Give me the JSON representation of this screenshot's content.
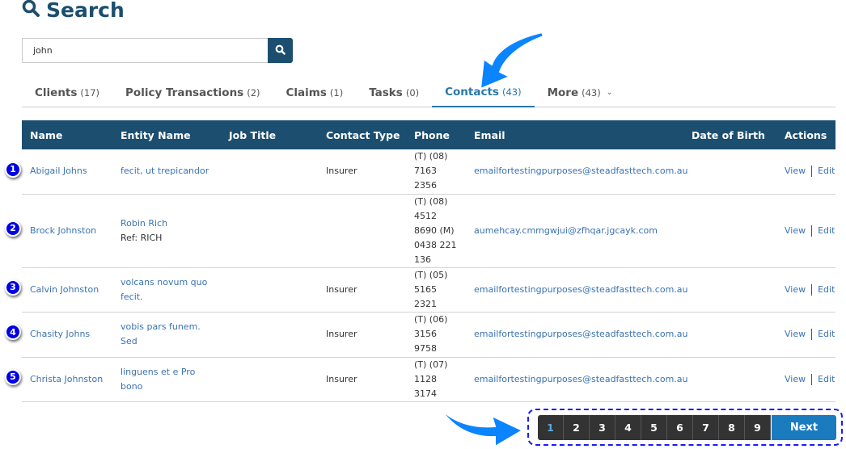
{
  "page": {
    "title": "Search"
  },
  "search": {
    "value": "john"
  },
  "tabs": [
    {
      "label": "Clients",
      "count": "(17)"
    },
    {
      "label": "Policy Transactions",
      "count": "(2)"
    },
    {
      "label": "Claims",
      "count": "(1)"
    },
    {
      "label": "Tasks",
      "count": "(0)"
    },
    {
      "label": "Contacts",
      "count": "(43)"
    },
    {
      "label": "More",
      "count": "(43)"
    }
  ],
  "table": {
    "headers": [
      "Name",
      "Entity Name",
      "Job Title",
      "Contact Type",
      "Phone",
      "Email",
      "Date of Birth",
      "Actions"
    ],
    "rows": [
      {
        "badge": "1",
        "name": "Abigail Johns",
        "entity": "fecit, ut trepicandor",
        "ref": "",
        "job": "",
        "type": "Insurer",
        "phone": "(T) (08) 7163 2356",
        "email": "emailfortestingpurposes@steadfasttech.com.au",
        "dob": "",
        "view": "View",
        "edit": "Edit"
      },
      {
        "badge": "2",
        "name": "Brock Johnston",
        "entity": "Robin Rich",
        "ref": "Ref: RICH",
        "job": "",
        "type": "",
        "phone": "(T) (08) 4512 8690 (M) 0438 221 136",
        "email": "aumehcay.cmmgwjui@zfhqar.jgcayk.com",
        "dob": "",
        "view": "View",
        "edit": "Edit"
      },
      {
        "badge": "3",
        "name": "Calvin Johnston",
        "entity": "volcans novum quo fecit.",
        "ref": "",
        "job": "",
        "type": "Insurer",
        "phone": "(T) (05) 5165 2321",
        "email": "emailfortestingpurposes@steadfasttech.com.au",
        "dob": "",
        "view": "View",
        "edit": "Edit"
      },
      {
        "badge": "4",
        "name": "Chasity Johns",
        "entity": "vobis pars funem. Sed",
        "ref": "",
        "job": "",
        "type": "Insurer",
        "phone": "(T) (06) 3156 9758",
        "email": "emailfortestingpurposes@steadfasttech.com.au",
        "dob": "",
        "view": "View",
        "edit": "Edit"
      },
      {
        "badge": "5",
        "name": "Christa Johnston",
        "entity": "linguens et e Pro bono",
        "ref": "",
        "job": "",
        "type": "Insurer",
        "phone": "(T) (07) 1128 3174",
        "email": "emailfortestingpurposes@steadfasttech.com.au",
        "dob": "",
        "view": "View",
        "edit": "Edit"
      }
    ]
  },
  "pagination": {
    "pages": [
      "1",
      "2",
      "3",
      "4",
      "5",
      "6",
      "7",
      "8",
      "9"
    ],
    "current": "1",
    "next": "Next"
  },
  "colors": {
    "primary": "#1b4e6f",
    "link": "#3a72b0",
    "active_tab": "#2a78a8",
    "next": "#1a7bbf",
    "badge": "#0000e6"
  }
}
